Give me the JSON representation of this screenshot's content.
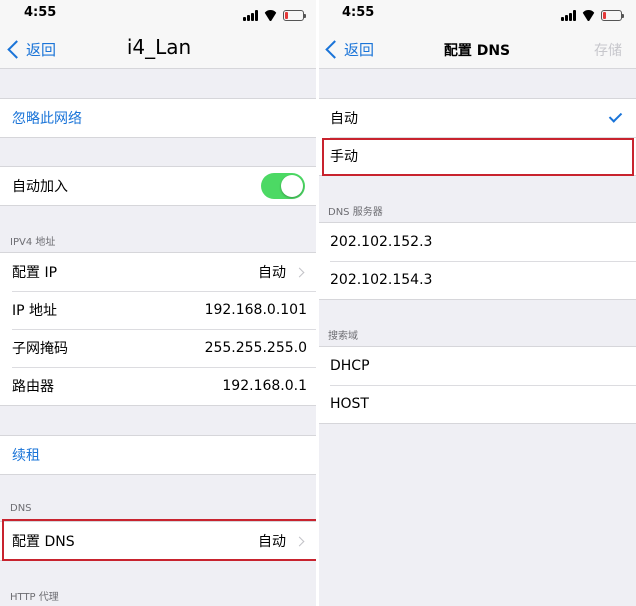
{
  "status": {
    "time": "4:55"
  },
  "left": {
    "back_label": "返回",
    "title": "i4_Lan",
    "forget_network": "忽略此网络",
    "auto_join_label": "自动加入",
    "auto_join_on": true,
    "ipv4_header": "IPV4 地址",
    "ipv4_rows": [
      {
        "label": "配置 IP",
        "value": "自动"
      },
      {
        "label": "IP 地址",
        "value": "192.168.0.101"
      },
      {
        "label": "子网掩码",
        "value": "255.255.255.0"
      },
      {
        "label": "路由器",
        "value": "192.168.0.1"
      }
    ],
    "renew_lease": "续租",
    "dns_header": "DNS",
    "configure_dns": {
      "label": "配置 DNS",
      "value": "自动"
    },
    "http_proxy_header": "HTTP 代理"
  },
  "right": {
    "back_label": "返回",
    "title": "配置 DNS",
    "save_label": "存储",
    "mode_options": [
      "自动",
      "手动"
    ],
    "selected_mode": "自动",
    "dns_servers_header": "DNS 服务器",
    "dns_servers": [
      "202.102.152.3",
      "202.102.154.3"
    ],
    "search_domains_header": "搜索域",
    "search_domains": [
      "DHCP",
      "HOST"
    ]
  },
  "colors": {
    "link_blue": "#1a74d8",
    "toggle_green": "#4cd964",
    "highlight_red": "#c8232e",
    "battery_red": "#e43a3a"
  }
}
